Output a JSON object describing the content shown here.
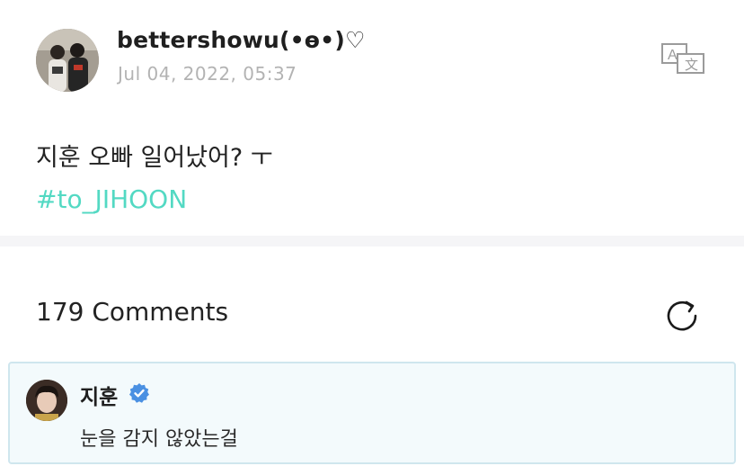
{
  "post": {
    "username": "bettershowu(•ɵ•)♡",
    "timestamp": "Jul 04, 2022, 05:37",
    "text": "지훈 오빠 일어났어? ㅜ",
    "hashtag": "#to_JIHOON"
  },
  "icons": {
    "avatar": "user-avatar-photo",
    "translate": "translate-icon",
    "refresh": "refresh-icon",
    "verified": "verified-badge-icon"
  },
  "comments": {
    "header": "179 Comments",
    "items": [
      {
        "author": "지훈",
        "verified": true,
        "text": "눈을 감지 않았는걸"
      }
    ]
  },
  "colors": {
    "hashtag": "#53d9c3",
    "verified": "#4a90e2",
    "comment_border": "#cfe6ee",
    "comment_bg": "#f3fafc",
    "timestamp": "#b3b3b3"
  }
}
